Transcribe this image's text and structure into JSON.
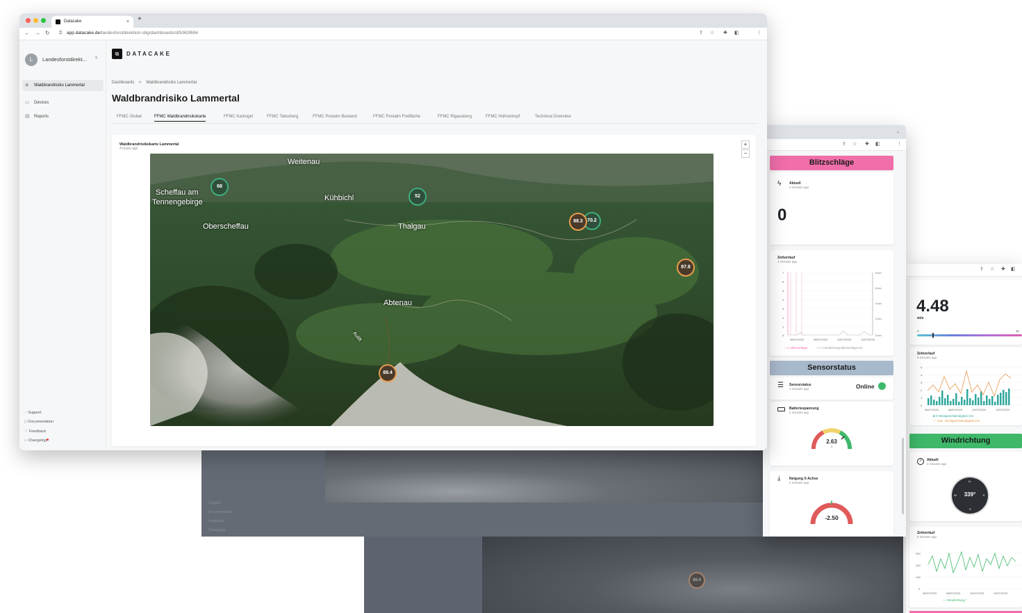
{
  "browser": {
    "tab_title": "Datacake",
    "tab_close": "×",
    "new_tab": "+",
    "url_host": "app.datacake.de",
    "url_path": "/landesforstdirektion-sbg/dashboards/d/5063f694"
  },
  "sidebar": {
    "avatar_letter": "L",
    "org_name": "Landesforstdirekt...",
    "items": [
      {
        "label": "Waldbrandrisiko Lammertal",
        "icon": "dashboard-icon"
      },
      {
        "label": "Devices",
        "icon": "devices-icon"
      },
      {
        "label": "Reports",
        "icon": "reports-icon"
      }
    ],
    "footer": [
      {
        "label": "Support",
        "icon": "support-icon"
      },
      {
        "label": "Documentation",
        "icon": "documentation-icon"
      },
      {
        "label": "Feedback",
        "icon": "feedback-icon"
      },
      {
        "label": "Changelog",
        "icon": "changelog-icon"
      }
    ]
  },
  "header": {
    "brand": "DATACAKE",
    "breadcrumb": [
      "Dashboards",
      ">",
      "Waldbrandrisiko Lammertal"
    ],
    "title": "Waldbrandrisiko Lammertal"
  },
  "tabs": [
    "FFMC Global",
    "FFMC Waldbrandrisikokarte",
    "FFMC Karkogel",
    "FFMC Taborberg",
    "FFMC Postalm Bestand",
    "FFMC Postalm Freifläche",
    "FFMC Rigausberg",
    "FFMC Hühnerkopf",
    "Technical Overview"
  ],
  "active_tab": 1,
  "map_card": {
    "title": "Waldbrandrisikokarte Lammertal",
    "subtitle": "4 hours ago",
    "zoom_in": "+",
    "zoom_out": "−",
    "places": [
      "Weitenau",
      "Scheffau am",
      "Tennengebirge",
      "Kühbichl",
      "Oberscheffau",
      "Thalgau",
      "Abtenau",
      "Aulift"
    ],
    "markers": [
      "68",
      "52",
      "88.3",
      "70.2",
      "87.8",
      "88.4"
    ]
  },
  "panel_right": {
    "blitz_banner": "Blitzschläge",
    "blitz_label": "Aktuell",
    "blitz_time": "2 minutes ago",
    "blitz_value": "0",
    "zeit_label": "Zeitverlauf",
    "zeit_time": "4 minutes ago",
    "zeit_y": [
      "7",
      "6",
      "5",
      "4",
      "3",
      "2",
      "1",
      "0"
    ],
    "zeit_y2": [
      "8 km",
      "6 km",
      "4 km",
      "2 km",
      "0 km"
    ],
    "zeit_x": [
      "06/07/2023",
      "08/07/2023",
      "10/07/2023",
      "12/07/2023"
    ],
    "zeit_legend1": "Blitzschläge",
    "zeit_legend2": "0 Entfernung Blitzschläge km",
    "sensor_banner": "Sensorstatus",
    "sensor_label": "Sensorstatus",
    "sensor_time": "2 minutes ago",
    "sensor_value": "Online",
    "batt_label": "Batteriespannung",
    "batt_time": "2 minutes ago",
    "batt_value": "2.63",
    "batt_unit": "V",
    "neig_label": "Neigung X-Achse",
    "neig_time": "2 minutes ago",
    "neig_value": "-2.50"
  },
  "panel_far": {
    "wind_value": "4.48",
    "wind_unit": "m/s",
    "wind_min": "0",
    "wind_max": "30",
    "zeit_label": "Zeitverlauf",
    "zeit_time": "5 minutes ago",
    "zeit_y": [
      "5",
      "4",
      "3",
      "2",
      "1",
      "0"
    ],
    "zeit_x": [
      "06/07/2023",
      "08/07/2023",
      "10/07/2023",
      "12/07/2023"
    ],
    "legend1": "0 Windgeschwindigkeit m/s",
    "legend2": "max. Windgeschwindigkeit m/s",
    "dir_banner": "Windrichtung",
    "dir_label": "Aktuell",
    "dir_time": "4 minutes ago",
    "dir_value": "339°",
    "zeit2_label": "Zeitverlauf",
    "zeit2_time": "5 minutes ago",
    "zeit2_y": [
      "300",
      "200",
      "100",
      "0"
    ],
    "legend3": "Windrichtung °"
  },
  "background_window": {
    "footer": [
      "Support",
      "Documentation",
      "Feedback",
      "Changelog"
    ],
    "marker": "88.4"
  },
  "colors": {
    "blitz": "#f06eaa",
    "sensor": "#a9b9cc",
    "wind": "#3fb86a",
    "accent_green": "#3fae7e",
    "accent_orange": "#e79e4f"
  }
}
